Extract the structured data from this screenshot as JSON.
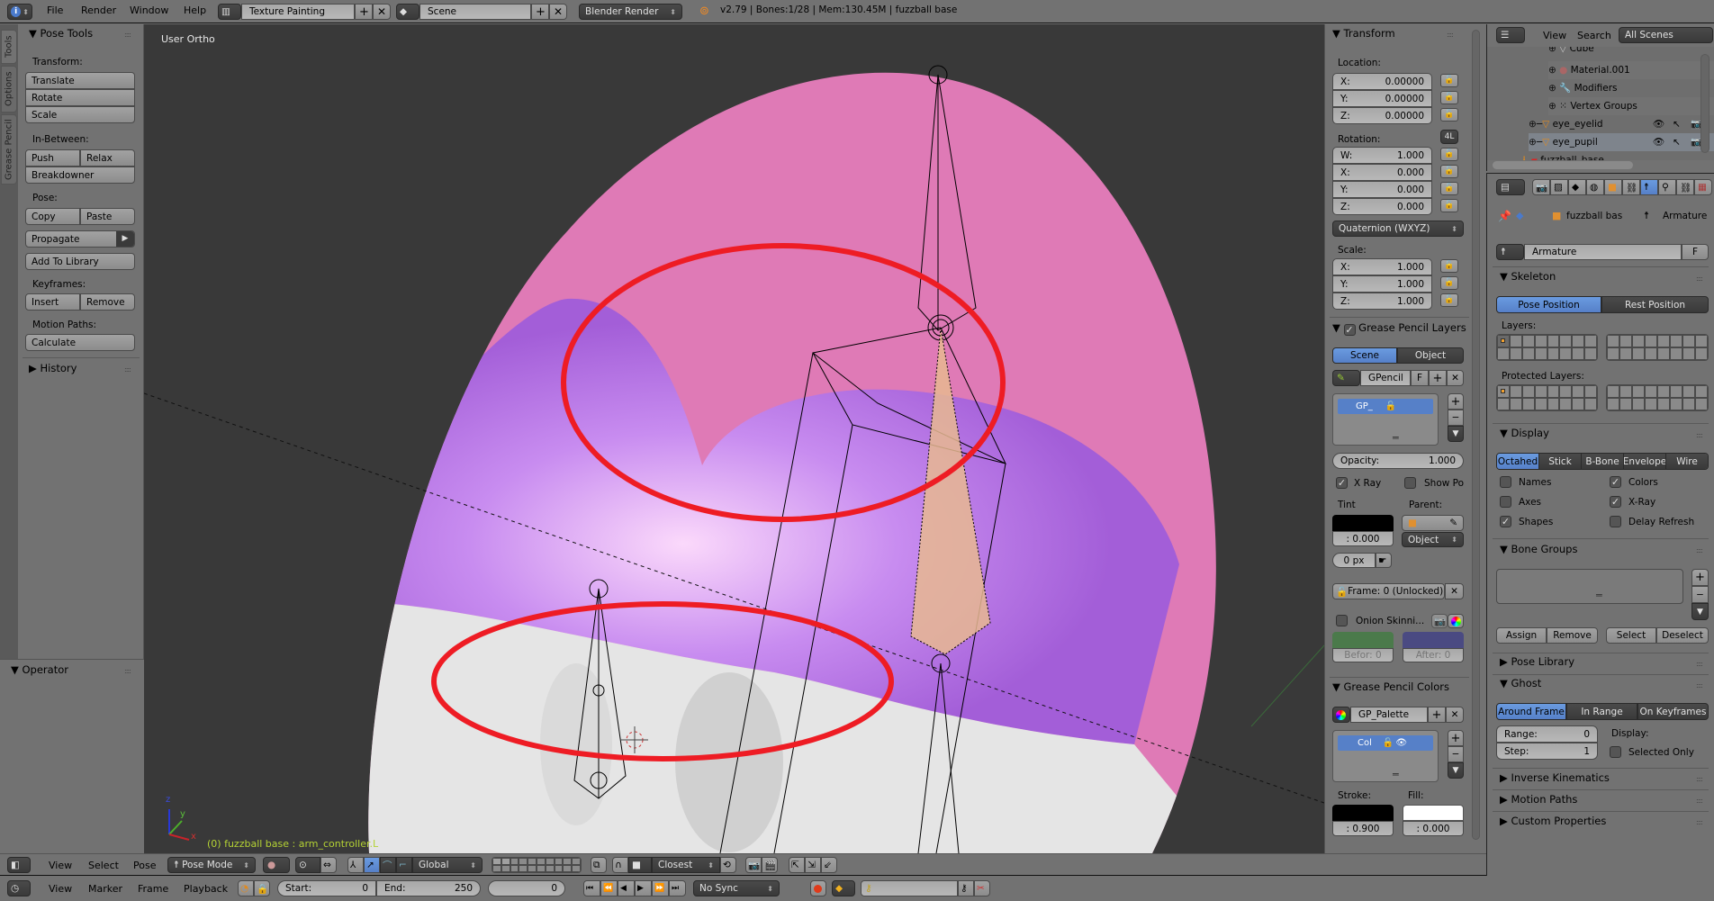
{
  "top_header": {
    "menus": [
      "File",
      "Render",
      "Window",
      "Help"
    ],
    "screen_layout": "Texture Painting",
    "scene": "Scene",
    "render_engine": "Blender Render",
    "status": "v2.79 | Bones:1/28  | Mem:130.45M | fuzzball base"
  },
  "tool_tabs": [
    "Tools",
    "Options",
    "Grease Pencil"
  ],
  "pose_tools": {
    "title": "Pose Tools",
    "transform_label": "Transform:",
    "translate": "Translate",
    "rotate": "Rotate",
    "scale": "Scale",
    "inbetween_label": "In-Between:",
    "push": "Push",
    "relax": "Relax",
    "breakdowner": "Breakdowner",
    "pose_label": "Pose:",
    "copy": "Copy",
    "paste": "Paste",
    "propagate": "Propagate",
    "add_to_library": "Add To Library",
    "keyframes_label": "Keyframes:",
    "insert": "Insert",
    "remove": "Remove",
    "motion_paths_label": "Motion Paths:",
    "calculate": "Calculate",
    "history": "History",
    "operator": "Operator"
  },
  "viewport": {
    "view_name": "User Ortho",
    "info_text": "(0) fuzzball base : arm_controller.L",
    "axes": {
      "x": "x",
      "y": "y",
      "z": "z"
    }
  },
  "n_panel": {
    "transform_title": "Transform",
    "location_label": "Location:",
    "location": [
      {
        "axis": "X:",
        "value": "0.00000"
      },
      {
        "axis": "Y:",
        "value": "0.00000"
      },
      {
        "axis": "Z:",
        "value": "0.00000"
      }
    ],
    "rotation_label": "Rotation:",
    "rotation_lock_4l": "4L",
    "rotation": [
      {
        "axis": "W:",
        "value": "1.000"
      },
      {
        "axis": "X:",
        "value": "0.000"
      },
      {
        "axis": "Y:",
        "value": "0.000"
      },
      {
        "axis": "Z:",
        "value": "0.000"
      }
    ],
    "rotation_mode": "Quaternion (WXYZ)",
    "scale_label": "Scale:",
    "scale": [
      {
        "axis": "X:",
        "value": "1.000"
      },
      {
        "axis": "Y:",
        "value": "1.000"
      },
      {
        "axis": "Z:",
        "value": "1.000"
      }
    ],
    "gp_layers_title": "Grease Pencil Layers",
    "gp_scene": "Scene",
    "gp_object": "Object",
    "gp_datablock": "GPencil",
    "gp_fake": "F",
    "gp_layer": "GP_",
    "opacity_label": "Opacity:",
    "opacity_value": "1.000",
    "xray": "X Ray",
    "show_points": "Show Po",
    "tint_label": "Tint",
    "tint_value": ": 0.000",
    "parent_label": "Parent:",
    "parent_type": "Object",
    "thickness": "0 px",
    "frame_lock": "Frame: 0 (Unlocked)",
    "onion": "Onion Skinni...",
    "before": "Befor: 0",
    "after": "After: 0",
    "gp_colors_title": "Grease Pencil Colors",
    "palette": "GP_Palette",
    "color_name": "Col",
    "stroke_label": "Stroke:",
    "stroke_value": ": 0.900",
    "fill_label": "Fill:",
    "fill_value": ": 0.000"
  },
  "outliner": {
    "view": "View",
    "search": "Search",
    "filter": "All Scenes",
    "items": [
      {
        "name": "Cube",
        "indent": 3
      },
      {
        "name": "Material.001",
        "indent": 3
      },
      {
        "name": "Modifiers",
        "indent": 3
      },
      {
        "name": "Vertex Groups",
        "indent": 3
      },
      {
        "name": "eye_eyelid",
        "indent": 2
      },
      {
        "name": "eye_pupil",
        "indent": 2
      },
      {
        "name": "fuzzball_base",
        "indent": 1
      }
    ]
  },
  "properties": {
    "breadcrumb_object": "fuzzball bas",
    "breadcrumb_data": "Armature",
    "datablock": "Armature",
    "datablock_fake": "F",
    "skeleton_title": "Skeleton",
    "pose_position": "Pose Position",
    "rest_position": "Rest Position",
    "layers_label": "Layers:",
    "protected_layers_label": "Protected Layers:",
    "display_title": "Display",
    "display_types": [
      "Octahed",
      "Stick",
      "B-Bone",
      "Envelope",
      "Wire"
    ],
    "display_active": "Octahed",
    "display_options": [
      {
        "label": "Names",
        "checked": false
      },
      {
        "label": "Colors",
        "checked": true
      },
      {
        "label": "Axes",
        "checked": false
      },
      {
        "label": "X-Ray",
        "checked": true
      },
      {
        "label": "Shapes",
        "checked": true
      },
      {
        "label": "Delay Refresh",
        "checked": false
      }
    ],
    "bone_groups_title": "Bone Groups",
    "assign": "Assign",
    "remove": "Remove",
    "select": "Select",
    "deselect": "Deselect",
    "pose_library": "Pose Library",
    "ghost_title": "Ghost",
    "ghost_types": [
      "Around Frame",
      "In Range",
      "On Keyframes"
    ],
    "range_label": "Range:",
    "range_value": "0",
    "step_label": "Step:",
    "step_value": "1",
    "display_label": "Display:",
    "selected_only": "Selected Only",
    "inverse_kinematics": "Inverse Kinematics",
    "motion_paths": "Motion Paths",
    "custom_properties": "Custom Properties"
  },
  "viewport_header": {
    "menus": [
      "View",
      "Select",
      "Pose"
    ],
    "mode": "Pose Mode",
    "orientation": "Global",
    "snap_target": "Closest"
  },
  "timeline": {
    "menus": [
      "View",
      "Marker",
      "Frame",
      "Playback"
    ],
    "start_label": "Start:",
    "start": "0",
    "end_label": "End:",
    "end": "250",
    "current_frame": "0",
    "sync": "No Sync"
  },
  "colors": {
    "accent": "#5680c8",
    "viewport_bg": "#393939",
    "panel_bg": "#727272",
    "mesh_pink": "#e07ab8",
    "mesh_purple": "#a866e0",
    "annotation_red": "#ee1c24",
    "info_text": "#b5d334"
  }
}
